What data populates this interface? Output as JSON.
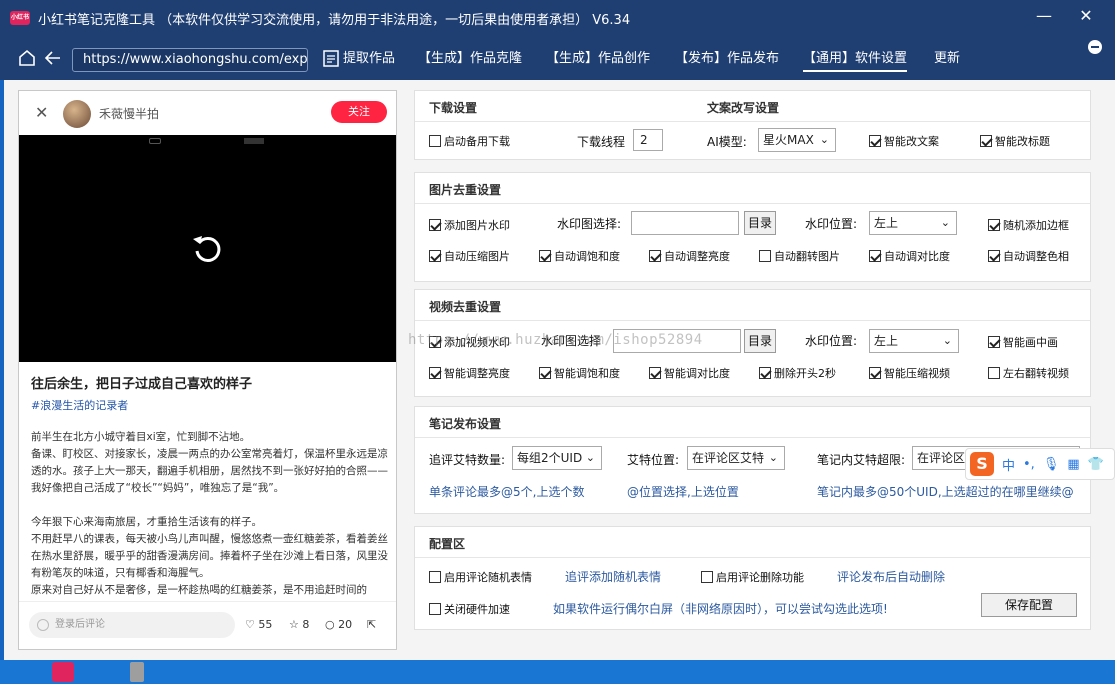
{
  "window": {
    "title": "小红书笔记克隆工具  （本软件仅供学习交流使用，请勿用于非法用途，一切后果由使用者承担）  V6.34",
    "minimize": "—",
    "close": "✕"
  },
  "nav": {
    "url": "https://www.xiaohongshu.com/explor",
    "tabs": [
      "提取作品",
      "【生成】作品克隆",
      "【生成】作品创作",
      "【发布】作品发布",
      "【通用】软件设置",
      "更新"
    ],
    "active_tab": "【通用】软件设置"
  },
  "post": {
    "author": "禾薇慢半拍",
    "follow_label": "关注",
    "title": "往后余生，把日子过成自己喜欢的样子",
    "tag": "#浪漫生活的记录者",
    "body": [
      "前半生在北方小城守着目xi室，忙到脚不沾地。",
      "备课、盯校区、对接家长，凌晨一两点的办公室常亮着灯，保温杯里永远是凉透的水。孩子上大一那天，翻遍手机相册，居然找不到一张好好拍的合照——我好像把自己活成了“校长”“妈妈”，唯独忘了是“我”。",
      "今年狠下心来海南旅居，才重拾生活该有的样子。",
      "不用赶早八的课表，每天被小鸟儿声叫醒，慢悠悠煮一壶红糖姜茶，看着姜丝在热水里舒展，暖乎乎的甜香漫满房间。捧着杯子坐在沙滩上看日落，风里没有粉笔灰的味道，只有椰香和海腥气。",
      "原来对自己好从不是奢侈，是一杯趁热喝的红糖姜茶，是不用追赶时间的"
    ],
    "comment_placeholder": "登录后评论",
    "likes": "55",
    "stars": "8",
    "comments": "20"
  },
  "download": {
    "title": "下载设置",
    "backup_download": "启动备用下载",
    "thread_label": "下载线程",
    "thread_value": "2"
  },
  "rewrite": {
    "title": "文案改写设置",
    "ai_label": "AI模型:",
    "ai_model": "星火MAX",
    "smart_copy": "智能改文案",
    "smart_title": "智能改标题"
  },
  "image": {
    "title": "图片去重设置",
    "add_watermark": "添加图片水印",
    "watermark_select": "水印图选择:",
    "watermark_value": "",
    "dir_btn": "目录",
    "pos_label": "水印位置:",
    "pos_value": "左上",
    "random_border": "随机添加边框",
    "options": [
      "自动压缩图片",
      "自动调饱和度",
      "自动调整亮度",
      "自动翻转图片",
      "自动调对比度",
      "自动调整色相"
    ]
  },
  "video": {
    "title": "视频去重设置",
    "add_watermark": "添加视频水印",
    "watermark_select": "水印图选择",
    "watermark_value": "",
    "dir_btn": "目录",
    "pos_label": "水印位置:",
    "pos_value": "左上",
    "pip": "智能画中画",
    "options": [
      "智能调整亮度",
      "智能调饱和度",
      "智能调对比度",
      "删除开头2秒",
      "智能压缩视频",
      "左右翻转视频"
    ]
  },
  "publish": {
    "title": "笔记发布设置",
    "reply_count_label": "追评艾特数量:",
    "reply_count_value": "每组2个UID",
    "at_pos_label": "艾特位置:",
    "at_pos_value": "在评论区艾特",
    "overflow_label": "笔记内艾特超限:",
    "overflow_value": "在评论区",
    "hint1": "单条评论最多@5个,上选个数",
    "hint2": "@位置选择,上选位置",
    "hint3": "笔记内最多@50个UID,上选超过的在哪里继续@"
  },
  "config": {
    "title": "配置区",
    "random_emoji": "启用评论随机表情",
    "random_emoji_link": "追评添加随机表情",
    "delete_enable": "启用评论删除功能",
    "delete_link": "评论发布后自动删除",
    "disable_hw": "关闭硬件加速",
    "hw_hint": "如果软件运行偶尔白屏（非网络原因时），可以尝试勾选此选项!",
    "save_btn": "保存配置"
  },
  "watermark_text": "https://www.huzhan.com/ishop52894",
  "ime": {
    "zh": "中",
    "punct": "•,"
  },
  "colors": {
    "titlebar": "#1f3f73",
    "accent": "#ff2442",
    "hint": "#2c5aa0"
  }
}
